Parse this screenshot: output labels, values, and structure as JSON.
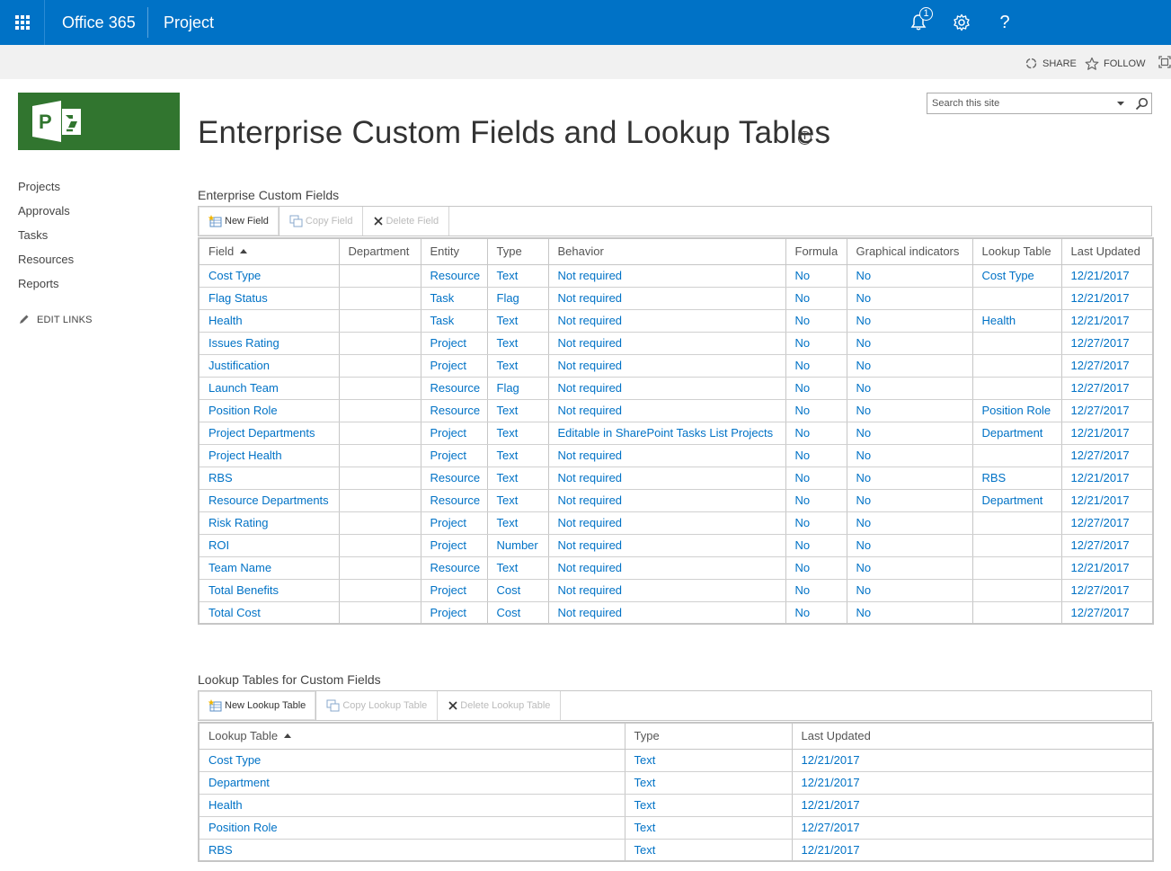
{
  "suite_bar": {
    "brand": "Office 365",
    "app": "Project",
    "notification_count": "1",
    "help_glyph": "?",
    "background_color": "#0072c6"
  },
  "ribbon": {
    "share_label": "SHARE",
    "follow_label": "FOLLOW"
  },
  "left_nav": {
    "items": [
      "Projects",
      "Approvals",
      "Tasks",
      "Resources",
      "Reports"
    ],
    "edit_links_label": "EDIT LINKS"
  },
  "page": {
    "title": "Enterprise Custom Fields and Lookup Tables",
    "info_glyph": "i"
  },
  "search": {
    "placeholder": "Search this site"
  },
  "custom_fields": {
    "section_title": "Enterprise Custom Fields",
    "toolbar": {
      "new_label": "New Field",
      "copy_label": "Copy Field",
      "delete_label": "Delete Field"
    },
    "columns": [
      "Field",
      "Department",
      "Entity",
      "Type",
      "Behavior",
      "Formula",
      "Graphical indicators",
      "Lookup Table",
      "Last Updated"
    ],
    "rows": [
      [
        "Cost Type",
        "",
        "Resource",
        "Text",
        "Not required",
        "No",
        "No",
        "Cost Type",
        "12/21/2017"
      ],
      [
        "Flag Status",
        "",
        "Task",
        "Flag",
        "Not required",
        "No",
        "No",
        "",
        "12/21/2017"
      ],
      [
        "Health",
        "",
        "Task",
        "Text",
        "Not required",
        "No",
        "No",
        "Health",
        "12/21/2017"
      ],
      [
        "Issues Rating",
        "",
        "Project",
        "Text",
        "Not required",
        "No",
        "No",
        "",
        "12/27/2017"
      ],
      [
        "Justification",
        "",
        "Project",
        "Text",
        "Not required",
        "No",
        "No",
        "",
        "12/27/2017"
      ],
      [
        "Launch Team",
        "",
        "Resource",
        "Flag",
        "Not required",
        "No",
        "No",
        "",
        "12/27/2017"
      ],
      [
        "Position Role",
        "",
        "Resource",
        "Text",
        "Not required",
        "No",
        "No",
        "Position Role",
        "12/27/2017"
      ],
      [
        "Project Departments",
        "",
        "Project",
        "Text",
        "Editable in SharePoint Tasks List Projects",
        "No",
        "No",
        "Department",
        "12/21/2017"
      ],
      [
        "Project Health",
        "",
        "Project",
        "Text",
        "Not required",
        "No",
        "No",
        "",
        "12/27/2017"
      ],
      [
        "RBS",
        "",
        "Resource",
        "Text",
        "Not required",
        "No",
        "No",
        "RBS",
        "12/21/2017"
      ],
      [
        "Resource Departments",
        "",
        "Resource",
        "Text",
        "Not required",
        "No",
        "No",
        "Department",
        "12/21/2017"
      ],
      [
        "Risk Rating",
        "",
        "Project",
        "Text",
        "Not required",
        "No",
        "No",
        "",
        "12/27/2017"
      ],
      [
        "ROI",
        "",
        "Project",
        "Number",
        "Not required",
        "No",
        "No",
        "",
        "12/27/2017"
      ],
      [
        "Team Name",
        "",
        "Resource",
        "Text",
        "Not required",
        "No",
        "No",
        "",
        "12/21/2017"
      ],
      [
        "Total Benefits",
        "",
        "Project",
        "Cost",
        "Not required",
        "No",
        "No",
        "",
        "12/27/2017"
      ],
      [
        "Total Cost",
        "",
        "Project",
        "Cost",
        "Not required",
        "No",
        "No",
        "",
        "12/27/2017"
      ]
    ]
  },
  "lookup_tables": {
    "section_title": "Lookup Tables for Custom Fields",
    "toolbar": {
      "new_label": "New Lookup Table",
      "copy_label": "Copy Lookup Table",
      "delete_label": "Delete Lookup Table"
    },
    "columns": [
      "Lookup Table",
      "Type",
      "Last Updated"
    ],
    "rows": [
      [
        "Cost Type",
        "Text",
        "12/21/2017"
      ],
      [
        "Department",
        "Text",
        "12/21/2017"
      ],
      [
        "Health",
        "Text",
        "12/21/2017"
      ],
      [
        "Position Role",
        "Text",
        "12/27/2017"
      ],
      [
        "RBS",
        "Text",
        "12/21/2017"
      ]
    ]
  }
}
